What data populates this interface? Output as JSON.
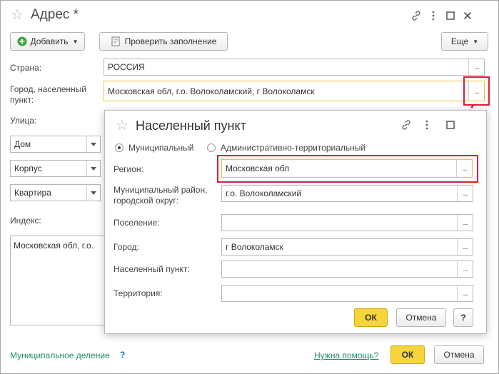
{
  "main": {
    "title": "Адрес *",
    "toolbar": {
      "add_label": "Добавить",
      "check_label": "Проверить заполнение",
      "more_label": "Еще"
    },
    "labels": {
      "country": "Страна:",
      "city_line1": "Город, населенный",
      "city_line2": "пункт:",
      "street": "Улица:",
      "index": "Индекс:"
    },
    "country_value": "РОССИЯ",
    "city_value": "Московская обл, г.о. Волоколамский, г Волоколамск",
    "selects": [
      "Дом",
      "Корпус",
      "Квартира"
    ],
    "address_text": "Московская обл, г.о.",
    "footer": {
      "municipal_division": "Муниципальное деление",
      "municipal_q": "?",
      "help_link": "Нужна помощь?",
      "ok_label": "ОК",
      "cancel_label": "Отмена"
    },
    "dots": "..."
  },
  "dialog": {
    "title": "Населенный пункт",
    "radio_municipal": "Муниципальный",
    "radio_admin": "Административно-территориальный",
    "fields": [
      {
        "label": "Регион:",
        "value": "Московская обл"
      },
      {
        "label1": "Муниципальный район,",
        "label2": "городской округ:",
        "value": "г.о. Волоколамский"
      },
      {
        "label": "Поселение:",
        "value": ""
      },
      {
        "label": "Город:",
        "value": "г Волоколамск"
      },
      {
        "label": "Населенный пункт:",
        "value": ""
      },
      {
        "label": "Территория:",
        "value": ""
      }
    ],
    "ok_label": "ОК",
    "cancel_label": "Отмена",
    "help_label": "?"
  },
  "colors": {
    "highlight_red": "#e3183b",
    "ok_yellow": "#f6d53b",
    "link_green": "#1f8a6b"
  }
}
